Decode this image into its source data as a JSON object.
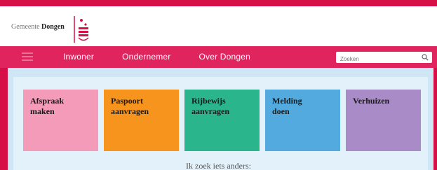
{
  "header": {
    "municipality": "Gemeente",
    "city": "Dongen"
  },
  "nav": {
    "items": [
      {
        "label": "Inwoner"
      },
      {
        "label": "Ondernemer"
      },
      {
        "label": "Over Dongen"
      }
    ],
    "search_placeholder": "Zoeken"
  },
  "tiles": [
    {
      "line1": "Afspraak",
      "line2": "maken"
    },
    {
      "line1": "Paspoort",
      "line2": "aanvragen"
    },
    {
      "line1": "Rijbewijs",
      "line2": "aanvragen"
    },
    {
      "line1": "Melding",
      "line2": "doen"
    },
    {
      "line1": "Verhuizen",
      "line2": ""
    }
  ],
  "other_label": "Ik zoek iets anders:",
  "colors": {
    "brand": "#d70f47",
    "nav": "#e0245e",
    "tile_pink": "#f39bb8",
    "tile_orange": "#f7941d",
    "tile_green": "#2bb58d",
    "tile_blue": "#52aadf",
    "tile_purple": "#a98cc7"
  }
}
